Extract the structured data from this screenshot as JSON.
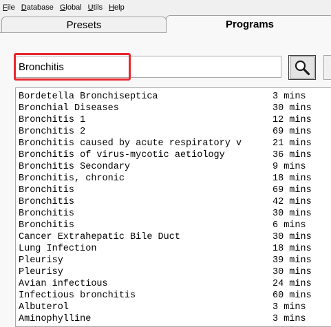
{
  "menu": [
    {
      "label": "File",
      "accel": "F",
      "rest": "ile"
    },
    {
      "label": "Database",
      "accel": "D",
      "rest": "atabase"
    },
    {
      "label": "Global",
      "accel": "G",
      "rest": "lobal"
    },
    {
      "label": "Utils",
      "accel": "U",
      "rest": "tils"
    },
    {
      "label": "Help",
      "accel": "H",
      "rest": "elp"
    }
  ],
  "tabs": {
    "presets": "Presets",
    "programs": "Programs",
    "active": "Programs"
  },
  "search": {
    "value": "Bronchitis",
    "highlight_color": "#e8262d",
    "button_icon": "magnifier-icon"
  },
  "results": [
    {
      "name": "Bordetella Bronchiseptica",
      "duration": "3 mins"
    },
    {
      "name": "Bronchial Diseases",
      "duration": "30 mins"
    },
    {
      "name": "Bronchitis 1",
      "duration": "12 mins"
    },
    {
      "name": "Bronchitis 2",
      "duration": "69 mins"
    },
    {
      "name": "Bronchitis caused by acute respiratory v",
      "duration": "21 mins"
    },
    {
      "name": "Bronchitis of virus-mycotic aetiology",
      "duration": "36 mins"
    },
    {
      "name": "Bronchitis Secondary",
      "duration": "9 mins"
    },
    {
      "name": "Bronchitis, chronic",
      "duration": "18 mins"
    },
    {
      "name": "Bronchitis",
      "duration": "69 mins"
    },
    {
      "name": "Bronchitis",
      "duration": "42 mins"
    },
    {
      "name": "Bronchitis",
      "duration": "30 mins"
    },
    {
      "name": "Bronchitis",
      "duration": "6 mins"
    },
    {
      "name": "Cancer Extrahepatic Bile Duct",
      "duration": "30 mins"
    },
    {
      "name": "Lung Infection",
      "duration": "18 mins"
    },
    {
      "name": "Pleurisy",
      "duration": "39 mins"
    },
    {
      "name": "Pleurisy",
      "duration": "30 mins"
    },
    {
      "name": "Avian infectious",
      "duration": "24 mins"
    },
    {
      "name": "Infectious bronchitis",
      "duration": "60 mins"
    },
    {
      "name": "Albuterol",
      "duration": "3 mins"
    },
    {
      "name": "Aminophylline",
      "duration": "3 mins"
    }
  ]
}
